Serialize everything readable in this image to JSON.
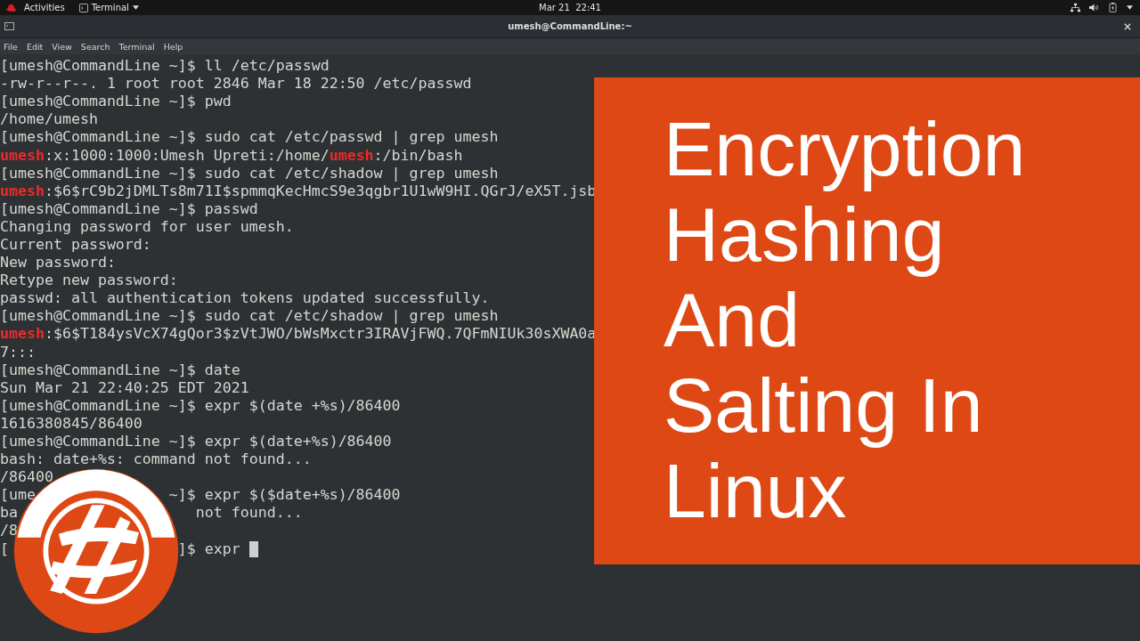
{
  "top_bar": {
    "activities": "Activities",
    "app_menu": "Terminal",
    "clock": "Mar 21  22:41"
  },
  "window": {
    "title": "umesh@CommandLine:~"
  },
  "menu": [
    "File",
    "Edit",
    "View",
    "Search",
    "Terminal",
    "Help"
  ],
  "terminal": {
    "lines": [
      {
        "text": "[umesh@CommandLine ~]$ ll /etc/passwd"
      },
      {
        "text": "-rw-r--r--. 1 root root 2846 Mar 18 22:50 /etc/passwd"
      },
      {
        "text": "[umesh@CommandLine ~]$ pwd"
      },
      {
        "text": "/home/umesh"
      },
      {
        "text": "[umesh@CommandLine ~]$ sudo cat /etc/passwd | grep umesh"
      },
      {
        "text": "**umesh**:x:1000:1000:Umesh Upreti:/home/**umesh**:/bin/bash"
      },
      {
        "text": "[umesh@CommandLine ~]$ sudo cat /etc/shadow | grep umesh"
      },
      {
        "text": "**umesh**:$6$rC9b2jDMLTs8m71I$spmmqKecHmcS9e3qgbr1U1wW9HI.QGrJ/eX5T.jsb"
      },
      {
        "text": "[umesh@CommandLine ~]$ passwd"
      },
      {
        "text": "Changing password for user umesh."
      },
      {
        "text": "Current password:"
      },
      {
        "text": "New password:"
      },
      {
        "text": "Retype new password:"
      },
      {
        "text": "passwd: all authentication tokens updated successfully."
      },
      {
        "text": "[umesh@CommandLine ~]$ sudo cat /etc/shadow | grep umesh"
      },
      {
        "text": "**umesh**:$6$T184ysVcX74gQor3$zVtJWO/bWsMxctr3IRAVjFWQ.7QFmNIUk30sXWA0a"
      },
      {
        "text": "7:::"
      },
      {
        "text": "[umesh@CommandLine ~]$ date"
      },
      {
        "text": "Sun Mar 21 22:40:25 EDT 2021"
      },
      {
        "text": "[umesh@CommandLine ~]$ expr $(date +%s)/86400"
      },
      {
        "text": "1616380845/86400"
      },
      {
        "text": "[umesh@CommandLine ~]$ expr $(date+%s)/86400"
      },
      {
        "text": "bash: date+%s: command not found..."
      },
      {
        "text": "/86400"
      },
      {
        "parts": [
          "[ume",
          "~]$ expr $($date+%s)/86400"
        ]
      },
      {
        "parts": [
          "ba",
          "not found..."
        ]
      },
      {
        "text": "/8"
      },
      {
        "parts": [
          "[",
          "]$ expr"
        ],
        "cursor": true
      }
    ]
  },
  "banner": {
    "title_lines": [
      "Encryption",
      "Hashing",
      "And",
      "Salting In",
      "Linux"
    ]
  }
}
